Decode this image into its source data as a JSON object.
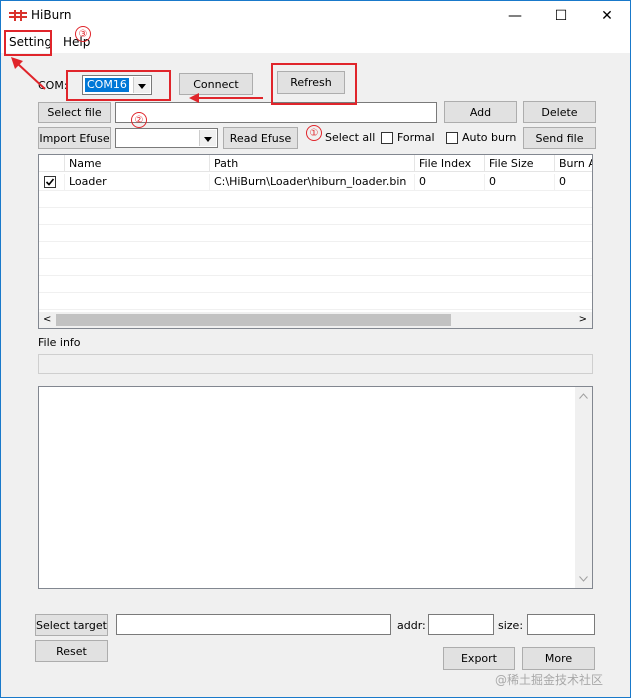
{
  "window": {
    "title": "HiBurn",
    "minimize": "—",
    "maximize": "☐",
    "close": "✕"
  },
  "menu": {
    "setting": "Setting",
    "help": "Help"
  },
  "com": {
    "label": "COM:",
    "selected": "COM16"
  },
  "buttons": {
    "connect": "Connect",
    "refresh": "Refresh",
    "select_file": "Select file",
    "add": "Add",
    "delete": "Delete",
    "import_efuse": "Import Efuse",
    "read_efuse": "Read Efuse",
    "send_file": "Send file",
    "select_target": "Select target",
    "reset": "Reset",
    "export": "Export",
    "more": "More"
  },
  "checkboxes": {
    "select_all": "Select all",
    "formal": "Formal",
    "auto_burn": "Auto burn"
  },
  "table": {
    "columns": [
      "Name",
      "Path",
      "File Index",
      "File Size",
      "Burn A"
    ],
    "rows": [
      {
        "checked": true,
        "name": "Loader",
        "path": "C:\\HiBurn\\Loader\\hiburn_loader.bin",
        "file_index": "0",
        "file_size": "0",
        "burn_addr": "0"
      }
    ]
  },
  "file_info": {
    "label": "File info",
    "value": ""
  },
  "target": {
    "addr_label": "addr:",
    "size_label": "size:"
  },
  "annotations": {
    "one": "①",
    "two": "②",
    "three": "③"
  },
  "watermark": "@稀土掘金技术社区",
  "colors": {
    "annotation": "#e0252b",
    "selection": "#0078d7",
    "border": "#1979ca"
  }
}
